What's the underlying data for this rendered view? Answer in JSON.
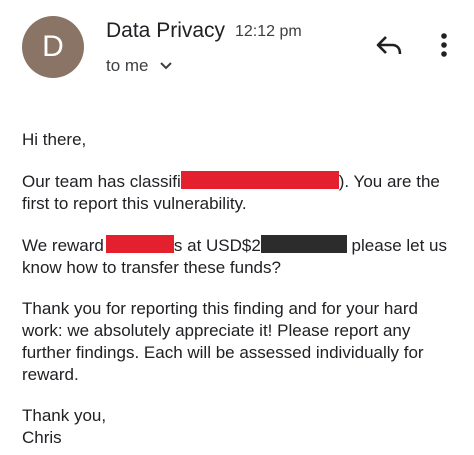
{
  "header": {
    "avatar_letter": "D",
    "sender_name": "Data Privacy",
    "time": "12:12 pm",
    "recipient": "to me"
  },
  "icons": {
    "reply": "reply-icon",
    "more": "more-vert-icon",
    "chevron": "chevron-down-icon"
  },
  "colors": {
    "avatar_bg": "#8a7466",
    "redaction_red": "#e5202e",
    "redaction_dark": "#2c2c2c"
  },
  "body": {
    "greeting": "Hi there,",
    "p1_start": "Our team has classifi",
    "p1_end": "). You are the first to report this vulnerability.",
    "p2_start": "We reward",
    "p2_mid": "s at USD$2",
    "p2_end": " please let us know how to transfer these funds?",
    "p3": "Thank you for reporting this finding and for your hard work: we absolutely appreciate it! Please report any further findings. Each will be assessed individually for reward.",
    "signoff": "Thank you,",
    "signature": "Chris"
  }
}
